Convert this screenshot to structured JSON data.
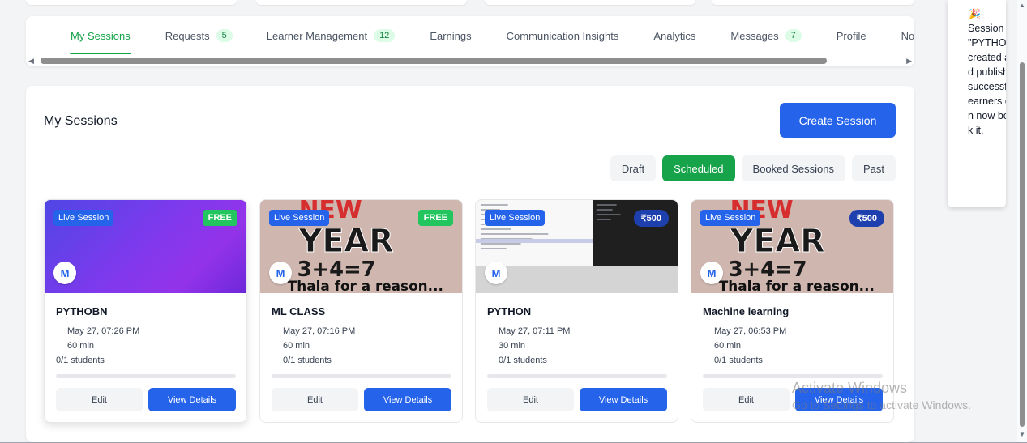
{
  "tabs": [
    {
      "label": "My Sessions",
      "badge": null,
      "active": true
    },
    {
      "label": "Requests",
      "badge": "5",
      "active": false
    },
    {
      "label": "Learner Management",
      "badge": "12",
      "active": false
    },
    {
      "label": "Earnings",
      "badge": null,
      "active": false
    },
    {
      "label": "Communication Insights",
      "badge": null,
      "active": false
    },
    {
      "label": "Analytics",
      "badge": null,
      "active": false
    },
    {
      "label": "Messages",
      "badge": "7",
      "active": false
    },
    {
      "label": "Profile",
      "badge": null,
      "active": false
    },
    {
      "label": "Not",
      "badge": null,
      "active": false
    }
  ],
  "panel": {
    "title": "My Sessions",
    "create_label": "Create Session",
    "filters": [
      {
        "label": "Draft",
        "active": false
      },
      {
        "label": "Scheduled",
        "active": true
      },
      {
        "label": "Booked Sessions",
        "active": false
      },
      {
        "label": "Past",
        "active": false
      }
    ]
  },
  "sessions": [
    {
      "title": "PYTHOBN",
      "live_label": "Live Session",
      "price": "FREE",
      "avatar": "M",
      "date": "May 27, 07:26 PM",
      "duration": "60 min",
      "students": "0/1 students",
      "edit_label": "Edit",
      "view_label": "View Details"
    },
    {
      "title": "ML CLASS",
      "live_label": "Live Session",
      "price": "FREE",
      "avatar": "M",
      "date": "May 27, 07:16 PM",
      "duration": "60 min",
      "students": "0/1 students",
      "edit_label": "Edit",
      "view_label": "View Details",
      "poster": {
        "line1": "NEW",
        "line2": "YEAR",
        "line3": "3+4=7",
        "line4": "Thala for a reason..."
      }
    },
    {
      "title": "PYTHON",
      "live_label": "Live Session",
      "price": "₹500",
      "avatar": "M",
      "date": "May 27, 07:11 PM",
      "duration": "30 min",
      "students": "0/1 students",
      "edit_label": "Edit",
      "view_label": "View Details"
    },
    {
      "title": "Machine learning",
      "live_label": "Live Session",
      "price": "₹500",
      "avatar": "M",
      "date": "May 27, 06:53 PM",
      "duration": "60 min",
      "students": "0/1 students",
      "edit_label": "Edit",
      "view_label": "View Details",
      "poster": {
        "line1": "NEW",
        "line2": "YEAR",
        "line3": "3+4=7",
        "line4": "Thala for a reason..."
      }
    }
  ],
  "toast": {
    "icon": "party-popper-icon",
    "text": "Session \"PYTHO \" created and publishe successf Learners can now book it."
  },
  "watermark": {
    "line1": "Activate Windows",
    "line2": "Go to Settings to activate Windows."
  },
  "colors": {
    "accent": "#16a34a",
    "primary": "#2563eb",
    "paid_badge": "#1e40af"
  }
}
